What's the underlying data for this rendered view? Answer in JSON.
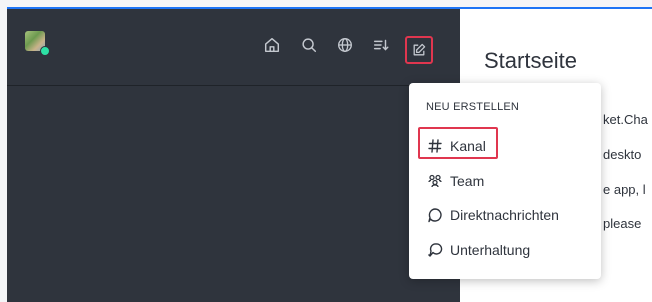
{
  "header": {
    "icons": [
      "home-icon",
      "search-icon",
      "globe-icon",
      "sort-icon",
      "edit-icon"
    ]
  },
  "main": {
    "title": "Startseite",
    "lines": [
      "ket.Cha",
      "deskto",
      "e app, l",
      "please"
    ]
  },
  "create_menu": {
    "heading": "NEU ERSTELLEN",
    "items": [
      {
        "label": "Kanal",
        "icon": "hash-icon"
      },
      {
        "label": "Team",
        "icon": "team-icon"
      },
      {
        "label": "Direktnachrichten",
        "icon": "chat-bubble-icon"
      },
      {
        "label": "Unterhaltung",
        "icon": "discussion-icon"
      }
    ]
  },
  "colors": {
    "sidebar": "#2f343d",
    "highlight": "#e0364f",
    "status_online": "#2de0a5",
    "top_bar": "#1d74f5"
  }
}
